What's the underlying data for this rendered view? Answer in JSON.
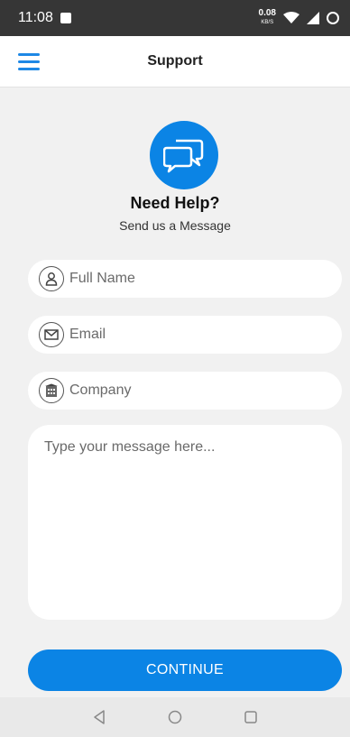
{
  "status": {
    "time": "11:08",
    "speed_value": "0.08",
    "speed_unit": "KB/S"
  },
  "appbar": {
    "title": "Support"
  },
  "hero": {
    "heading": "Need Help?",
    "subheading": "Send us a Message"
  },
  "form": {
    "full_name": {
      "placeholder": "Full Name",
      "value": ""
    },
    "email": {
      "placeholder": "Email",
      "value": ""
    },
    "company": {
      "placeholder": "Company",
      "value": ""
    },
    "message": {
      "placeholder": "Type your message here...",
      "value": ""
    },
    "continue_label": "CONTINUE"
  },
  "colors": {
    "accent": "#0b84e5",
    "statusbar": "#363636",
    "background": "#f1f1f1"
  },
  "icons": [
    "menu-icon",
    "chat-bubbles-icon",
    "person-icon",
    "envelope-icon",
    "building-icon",
    "back-icon",
    "home-icon",
    "recents-icon"
  ]
}
